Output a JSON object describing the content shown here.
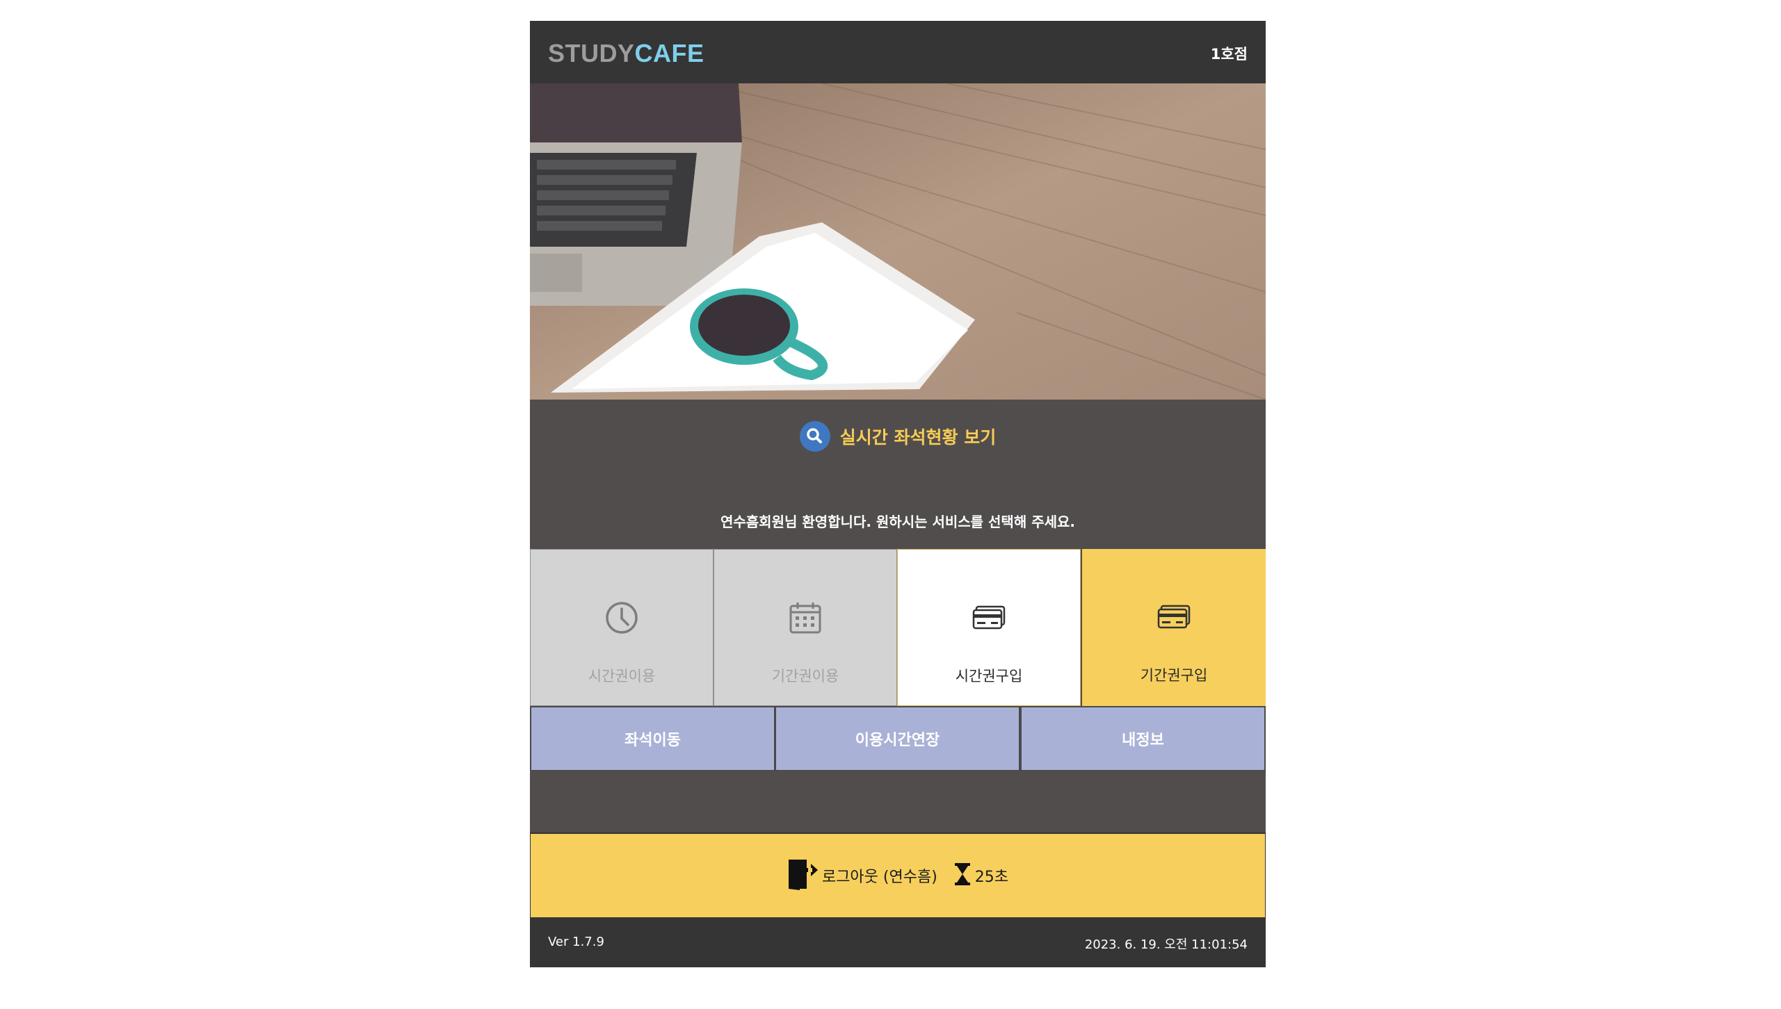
{
  "header": {
    "logo_part1": "STUDY",
    "logo_part2": "CAFE",
    "branch": "1호점"
  },
  "seat_status": {
    "label": "실시간 좌석현황 보기",
    "icon": "search-icon"
  },
  "welcome": "연수흠회원님 환영합니다. 원하시는 서비스를 선택해 주세요.",
  "tiles": [
    {
      "label": "시간권이용",
      "icon": "clock-icon",
      "state": "disabled"
    },
    {
      "label": "기간권이용",
      "icon": "calendar-icon",
      "state": "disabled"
    },
    {
      "label": "시간권구입",
      "icon": "credit-card-icon",
      "state": "active"
    },
    {
      "label": "기간권구입",
      "icon": "credit-card-icon",
      "state": "highlighted"
    }
  ],
  "actions": [
    {
      "label": "좌석이동"
    },
    {
      "label": "이용시간연장"
    },
    {
      "label": "내정보"
    }
  ],
  "logout": {
    "label": "로그아웃 (연수흠)",
    "countdown": "25초"
  },
  "footer": {
    "version": "Ver 1.7.9",
    "datetime": "2023. 6. 19. 오전 11:01:54"
  },
  "colors": {
    "header_bg": "#353535",
    "body_bg": "#524d4d",
    "accent_yellow": "#f6cf5d",
    "logo_blue": "#7ecfea",
    "action_bg": "#aab1d6"
  }
}
